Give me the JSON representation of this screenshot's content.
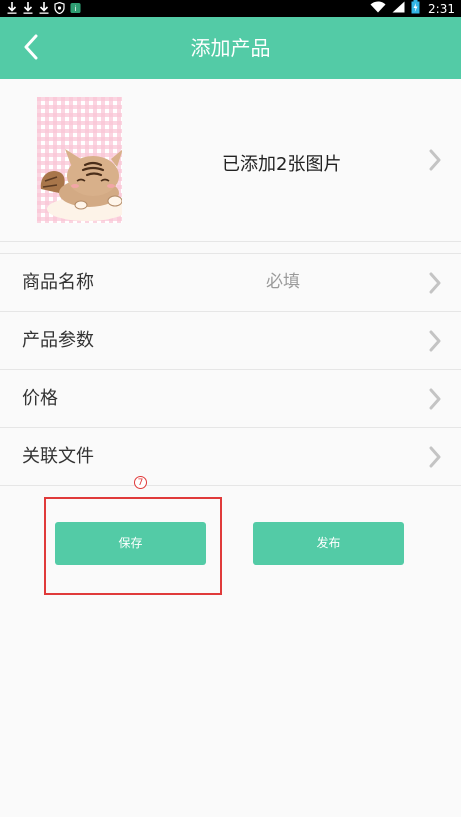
{
  "status_bar": {
    "time": "2:31",
    "icons": [
      "download-icon",
      "download-icon",
      "download-icon",
      "shield-icon",
      "app-icon",
      "wifi-icon",
      "signal-icon",
      "battery-charging-icon"
    ]
  },
  "header": {
    "title": "添加产品",
    "back_icon": "chevron-left-icon"
  },
  "images": {
    "count_text": "已添加2张图片"
  },
  "form": {
    "rows": [
      {
        "label": "商品名称",
        "value": "必填"
      },
      {
        "label": "产品参数",
        "value": ""
      },
      {
        "label": "价格",
        "value": ""
      },
      {
        "label": "关联文件",
        "value": ""
      }
    ]
  },
  "annotation": {
    "marker": "7"
  },
  "actions": {
    "save_label": "保存",
    "publish_label": "发布"
  },
  "colors": {
    "accent": "#53cba6",
    "highlight": "#e03a3a"
  }
}
